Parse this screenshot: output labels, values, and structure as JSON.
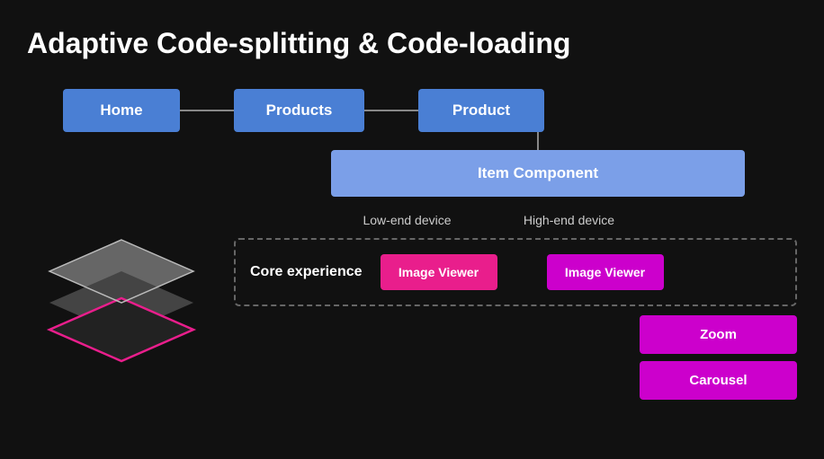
{
  "title": "Adaptive Code-splitting & Code-loading",
  "routes": {
    "home": "Home",
    "products": "Products",
    "product": "Product",
    "item_component": "Item Component"
  },
  "devices": {
    "low_end": "Low-end device",
    "high_end": "High-end device"
  },
  "core_label": "Core experience",
  "image_viewer": "Image Viewer",
  "features": {
    "zoom": "Zoom",
    "carousel": "Carousel"
  },
  "colors": {
    "route_box": "#4a7fd4",
    "item_component": "#7b9fe8",
    "image_viewer": "#e91e8c",
    "feature_box": "#cc00cc",
    "connector": "#888888"
  }
}
